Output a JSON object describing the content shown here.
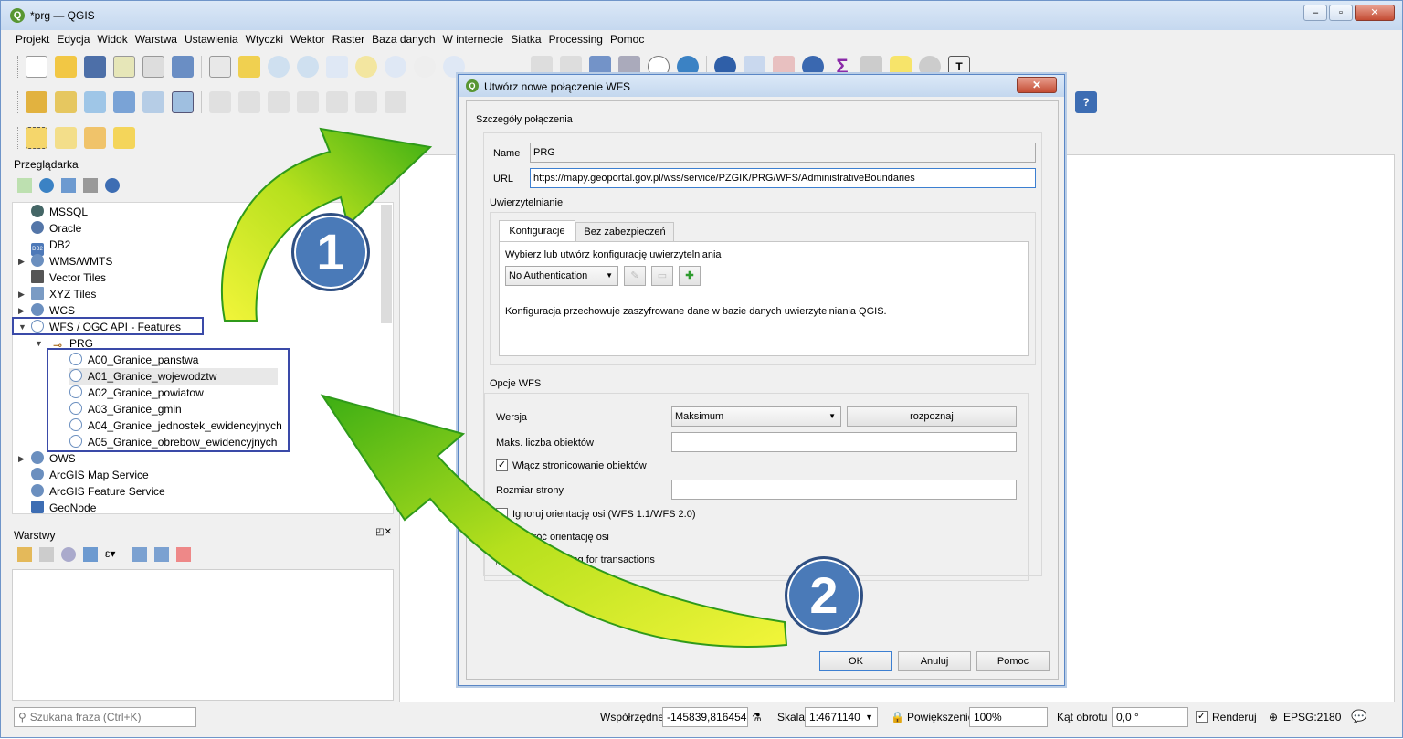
{
  "window": {
    "title": "*prg — QGIS"
  },
  "menu": [
    "Projekt",
    "Edycja",
    "Widok",
    "Warstwa",
    "Ustawienia",
    "Wtyczki",
    "Wektor",
    "Raster",
    "Baza danych",
    "W internecie",
    "Siatka",
    "Processing",
    "Pomoc"
  ],
  "browser": {
    "title": "Przeglądarka",
    "items": [
      "MSSQL",
      "Oracle",
      "DB2",
      "WMS/WMTS",
      "Vector Tiles",
      "XYZ Tiles",
      "WCS",
      "WFS / OGC API - Features",
      "PRG",
      "A00_Granice_panstwa",
      "A01_Granice_wojewodztw",
      "A02_Granice_powiatow",
      "A03_Granice_gmin",
      "A04_Granice_jednostek_ewidencyjnych",
      "A05_Granice_obrebow_ewidencyjnych",
      "OWS",
      "ArcGIS Map Service",
      "ArcGIS Feature Service",
      "GeoNode"
    ],
    "db2_icon": "DB2"
  },
  "layers": {
    "title": "Warstwy"
  },
  "status": {
    "search_placeholder": "Szukana fraza (Ctrl+K)",
    "coords_label": "Współrzędne",
    "coords": "-145839,816454",
    "scale_label": "Skala",
    "scale": "1:4671140",
    "zoom_label": "Powiększenie",
    "zoom": "100%",
    "rotation_label": "Kąt obrotu",
    "rotation": "0,0 °",
    "render": "Renderuj",
    "epsg": "EPSG:2180"
  },
  "dialog": {
    "title": "Utwórz nowe połączenie WFS",
    "details_group": "Szczegóły połączenia",
    "name_label": "Name",
    "name_value": "PRG",
    "url_label": "URL",
    "url_value": "https://mapy.geoportal.gov.pl/wss/service/PZGIK/PRG/WFS/AdministrativeBoundaries",
    "auth_group": "Uwierzytelnianie",
    "tab_config": "Konfiguracje",
    "tab_basic": "Bez zabezpieczeń",
    "auth_choose": "Wybierz lub utwórz konfigurację uwierzytelniania",
    "auth_select": "No Authentication",
    "auth_note": "Konfiguracja przechowuje zaszyfrowane dane w bazie danych uwierzytelniania QGIS.",
    "wfs_group": "Opcje WFS",
    "version_label": "Wersja",
    "version_value": "Maksimum",
    "detect_button": "rozpoznaj",
    "max_features_label": "Maks. liczba obiektów",
    "paging_label": "Włącz stronicowanie obiektów",
    "page_size_label": "Rozmiar strony",
    "ignore_axis_label": "Ignoruj orientację osi (WFS 1.1/WFS 2.0)",
    "invert_axis_label": "Odwróć orientację osi",
    "gml2_label": "GML2 encoding for transactions",
    "ok": "OK",
    "cancel": "Anuluj",
    "help": "Pomoc"
  },
  "annotations": {
    "step1": "1",
    "step2": "2"
  },
  "colors": {
    "highlight_box": "#3a4aa8",
    "step_circle": "#4a7ab8",
    "arrow_green": "#7ac70c"
  }
}
